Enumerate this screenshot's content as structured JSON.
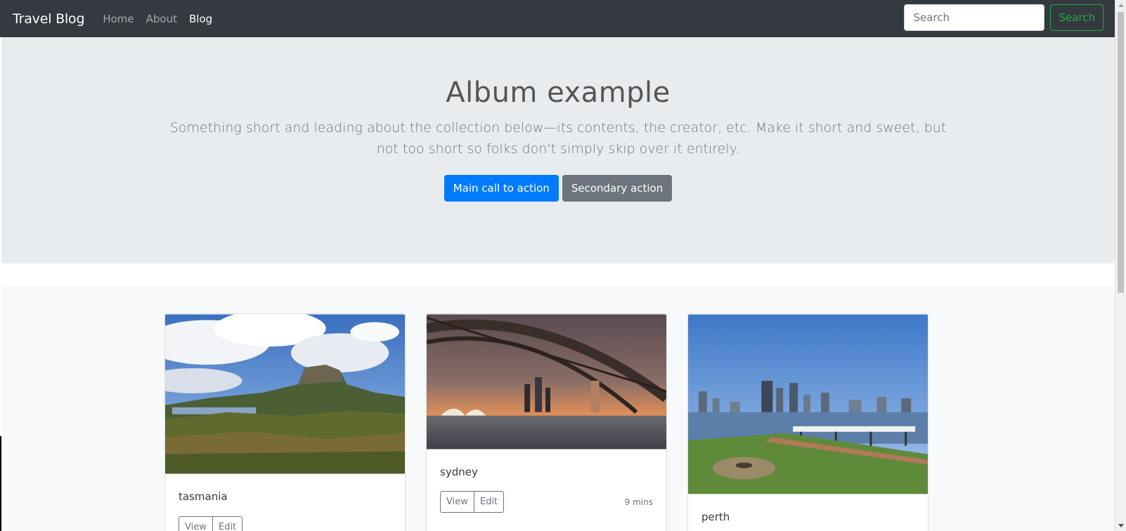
{
  "navbar": {
    "brand": "Travel Blog",
    "links": [
      "Home",
      "About",
      "Blog"
    ],
    "search_placeholder": "Search",
    "search_button": "Search"
  },
  "hero": {
    "title": "Album example",
    "lead": "Something short and leading about the collection below—its contents, the creator, etc. Make it short and sweet, but not too short so folks don't simply skip over it entirely.",
    "primary_button": "Main call to action",
    "secondary_button": "Secondary action"
  },
  "cards": [
    {
      "title": "tasmania",
      "view": "View",
      "edit": "Edit"
    },
    {
      "title": "sydney",
      "view": "View",
      "edit": "Edit",
      "time": "9 mins"
    },
    {
      "title": "perth"
    }
  ]
}
